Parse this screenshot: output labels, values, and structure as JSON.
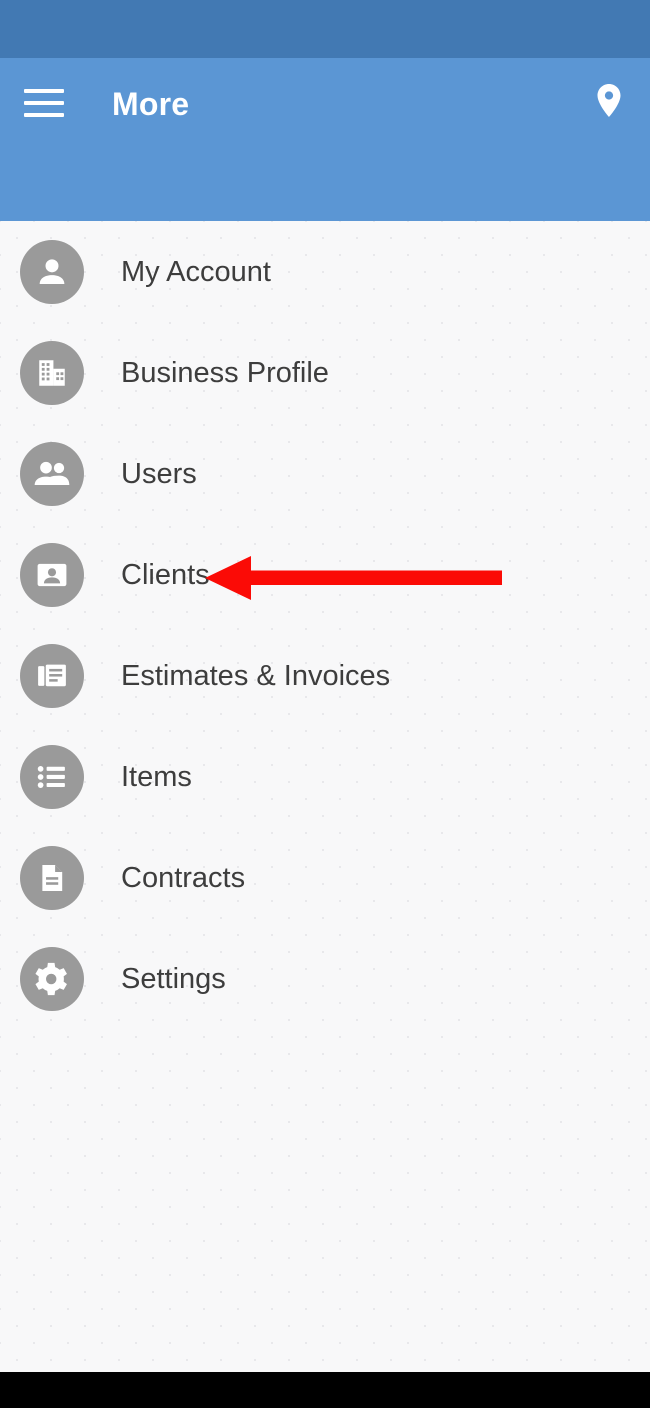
{
  "colors": {
    "status_bar": "#4279b3",
    "app_bar": "#5b96d4",
    "accent_white": "#ffffff",
    "icon_circle": "#9a9a9a",
    "label_text": "#3d3d3d",
    "page_background": "#f8f8f9",
    "annotation_red": "#fb0b06",
    "system_nav_bar": "#000000"
  },
  "app_bar": {
    "title": "More",
    "menu_icon": "hamburger-menu-icon",
    "location_icon": "location-pin-icon"
  },
  "tabs": [
    {
      "id": "dashboard",
      "icon": "dashboard-grid-icon",
      "active": false
    },
    {
      "id": "time",
      "icon": "clock-timer-icon",
      "active": false
    },
    {
      "id": "messages",
      "icon": "chat-message-icon",
      "active": false
    },
    {
      "id": "more",
      "icon": "ellipsis-more-icon",
      "active": true
    }
  ],
  "menu": {
    "items": [
      {
        "label": "My Account",
        "icon": "person-icon"
      },
      {
        "label": "Business Profile",
        "icon": "building-icon"
      },
      {
        "label": "Users",
        "icon": "people-group-icon"
      },
      {
        "label": "Clients",
        "icon": "contact-card-icon"
      },
      {
        "label": "Estimates & Invoices",
        "icon": "documents-stack-icon"
      },
      {
        "label": "Items",
        "icon": "bulleted-list-icon"
      },
      {
        "label": "Contracts",
        "icon": "document-page-icon"
      },
      {
        "label": "Settings",
        "icon": "gear-icon"
      }
    ]
  },
  "annotation": {
    "type": "left-arrow",
    "points_at": "Clients",
    "color": "#fb0b06"
  }
}
